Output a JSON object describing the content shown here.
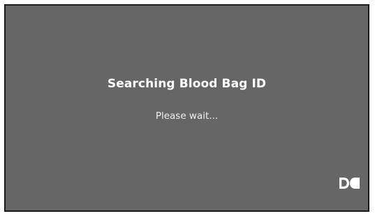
{
  "dialog": {
    "title": "Searching Blood Bag ID",
    "message": "Please wait...",
    "logo_icon": "brand-logo-icon"
  },
  "colors": {
    "background": "#666666",
    "border": "#1a1a1a",
    "text": "#ffffff"
  }
}
